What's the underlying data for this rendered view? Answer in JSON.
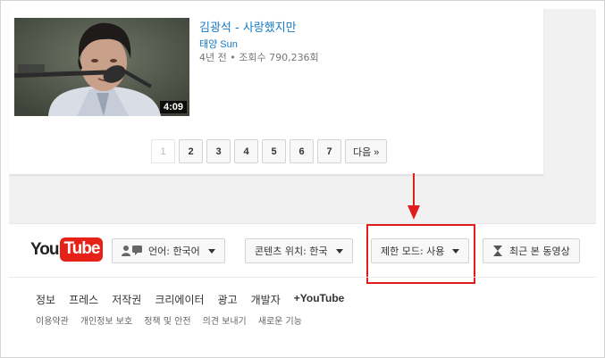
{
  "video": {
    "title": "김광석 - 사랑했지만",
    "channel": "태양 Sun",
    "meta": "4년 전 • 조회수 790,236회",
    "duration": "4:09"
  },
  "pagination": {
    "pages": [
      "1",
      "2",
      "3",
      "4",
      "5",
      "6",
      "7"
    ],
    "current": "1",
    "next_label": "다음 »"
  },
  "footer": {
    "logo_you": "You",
    "logo_tube": "Tube",
    "language_button": "언어: 한국어",
    "location_button": "콘텐츠 위치: 한국",
    "restricted_button": "제한 모드: 사용",
    "history_button": "최근 본 동영상",
    "primary_links": [
      "정보",
      "프레스",
      "저작권",
      "크리에이터",
      "광고",
      "개발자",
      "+YouTube"
    ],
    "secondary_links": [
      "이용약관",
      "개인정보 보호",
      "정책 및 안전",
      "의견 보내기",
      "새로운 기능"
    ]
  },
  "colors": {
    "link_blue": "#167ac6",
    "youtube_red": "#e62117",
    "annotation_red": "#e01d1d"
  }
}
